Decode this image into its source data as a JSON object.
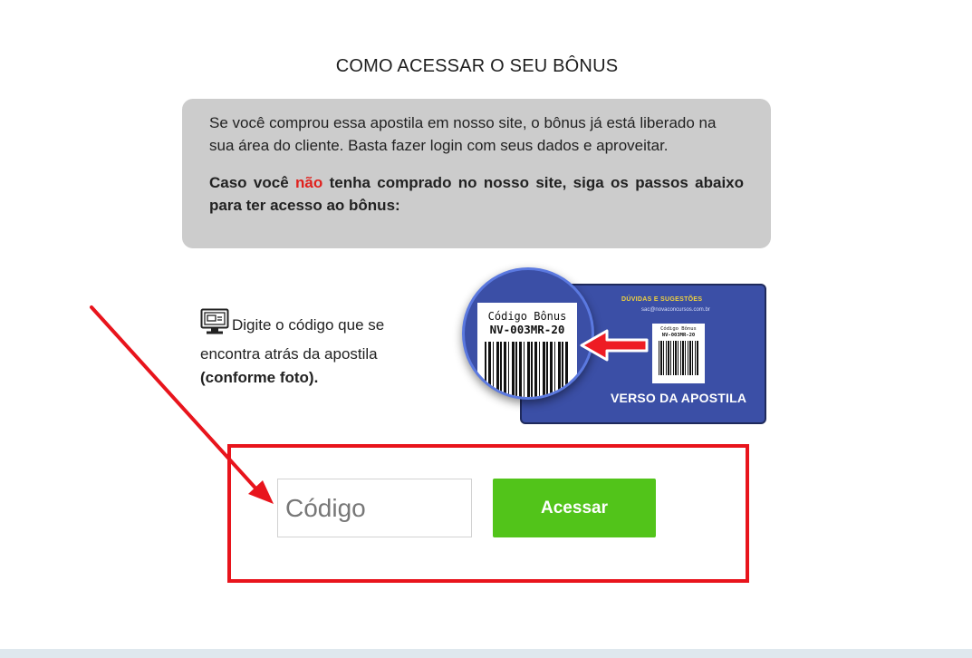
{
  "header": {
    "title": "COMO ACESSAR O SEU BÔNUS"
  },
  "info_box": {
    "paragraph1": "Se você comprou essa apostila em nosso site, o bônus já está liberado na sua área do cliente. Basta fazer login com seus dados e aproveitar.",
    "paragraph2_before": "Caso você ",
    "paragraph2_highlight": "não",
    "paragraph2_after": " tenha comprado no nosso site, siga os passos abaixo para ter acesso ao bônus:",
    "highlight_color": "#e0211d",
    "background_color": "#cccccc"
  },
  "instruction": {
    "icon": "computer-icon",
    "text": "Digite o código que se encontra atrás da apostila",
    "bold_text": "(conforme foto)."
  },
  "card_image": {
    "heading": "DÚVIDAS E SUGESTÕES",
    "email": "sac@novaconcursos.com.br",
    "label_line1": "Código Bônus",
    "label_line2": "NV-003MR-20",
    "footer": "VERSO DA APOSTILA",
    "card_color": "#3b4fa6"
  },
  "form": {
    "code_placeholder": "Código",
    "code_value": "",
    "submit_label": "Acessar",
    "button_color": "#52c41a"
  },
  "annotation": {
    "color": "#e8141c"
  }
}
